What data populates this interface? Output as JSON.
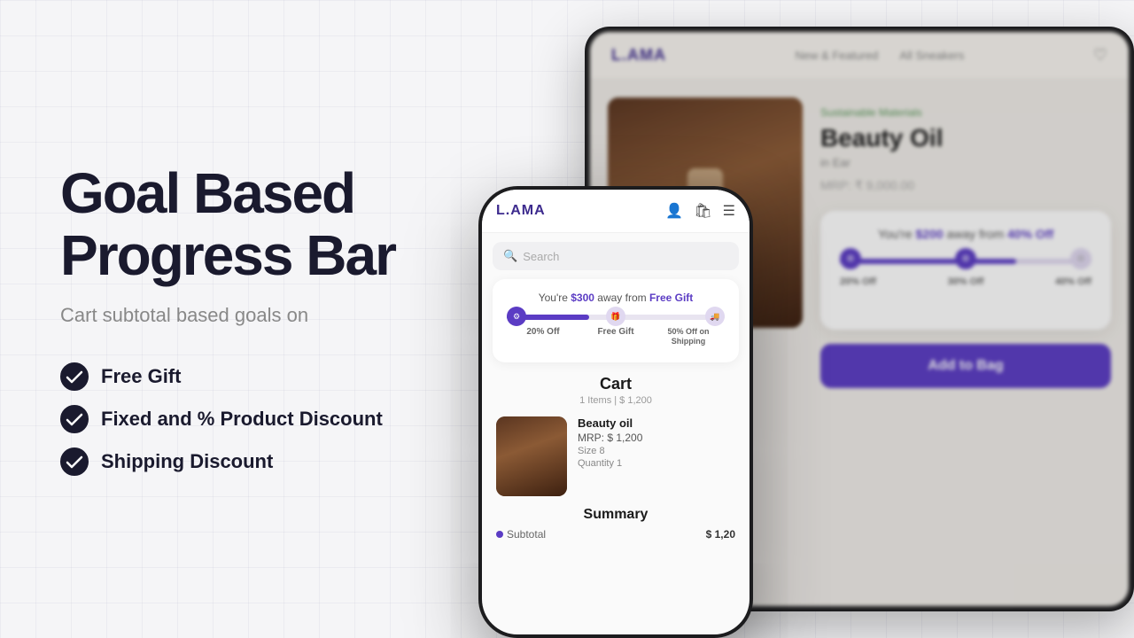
{
  "page": {
    "background": "#f5f5f7"
  },
  "left": {
    "headline_line1": "Goal Based",
    "headline_line2": "Progress Bar",
    "subtitle": "Cart subtotal based goals on",
    "features": [
      {
        "id": "free-gift",
        "label": "Free Gift"
      },
      {
        "id": "product-discount",
        "label": "Fixed and % Product Discount"
      },
      {
        "id": "shipping-discount",
        "label": "Shipping Discount"
      }
    ]
  },
  "phone": {
    "logo": "L.AMA",
    "search_placeholder": "Search",
    "progress_text_prefix": "You're ",
    "progress_amount": "$300",
    "progress_text_mid": " away from ",
    "progress_reward": "Free Gift",
    "markers": [
      {
        "label": "20% Off",
        "active": true,
        "icon": "⚙"
      },
      {
        "label": "Free Gift",
        "active": false,
        "icon": "🎁"
      },
      {
        "label": "50% Off on Shipping",
        "active": false,
        "icon": "🚚"
      }
    ],
    "cart_title": "Cart",
    "cart_meta": "1 Items | $ 1,200",
    "item_name": "Beauty oil",
    "item_mrp": "MRP: $ 1,200",
    "item_size": "Size  8",
    "item_qty": "Quantity 1",
    "summary_title": "Summary",
    "summary_subtotal_label": "Subtotal",
    "summary_subtotal_value": "$ 1,20"
  },
  "tablet": {
    "logo": "L.AMA",
    "nav_item1": "New & Featured",
    "nav_item2": "All Sneakers",
    "product_tag": "Sustainable Materials",
    "product_name": "Beauty Oil",
    "product_sub": "in Ear",
    "product_price": "MRP: ₹ 9,000.00",
    "progress_prefix": "You're ",
    "progress_amount": "$200",
    "progress_mid": " away from ",
    "progress_discount": "40% Off",
    "markers": [
      {
        "label": "20% Off",
        "active": true
      },
      {
        "label": "30% Off",
        "active": true
      },
      {
        "label": "40% Off",
        "active": false
      }
    ],
    "add_to_bag": "Add to Bag",
    "favourite_label": "Favourite"
  },
  "icons": {
    "check": "✓",
    "search": "🔍",
    "user": "👤",
    "bag": "🛍",
    "menu": "☰",
    "heart": "♡",
    "gear": "⚙",
    "gift": "🎁",
    "truck": "🚚"
  }
}
